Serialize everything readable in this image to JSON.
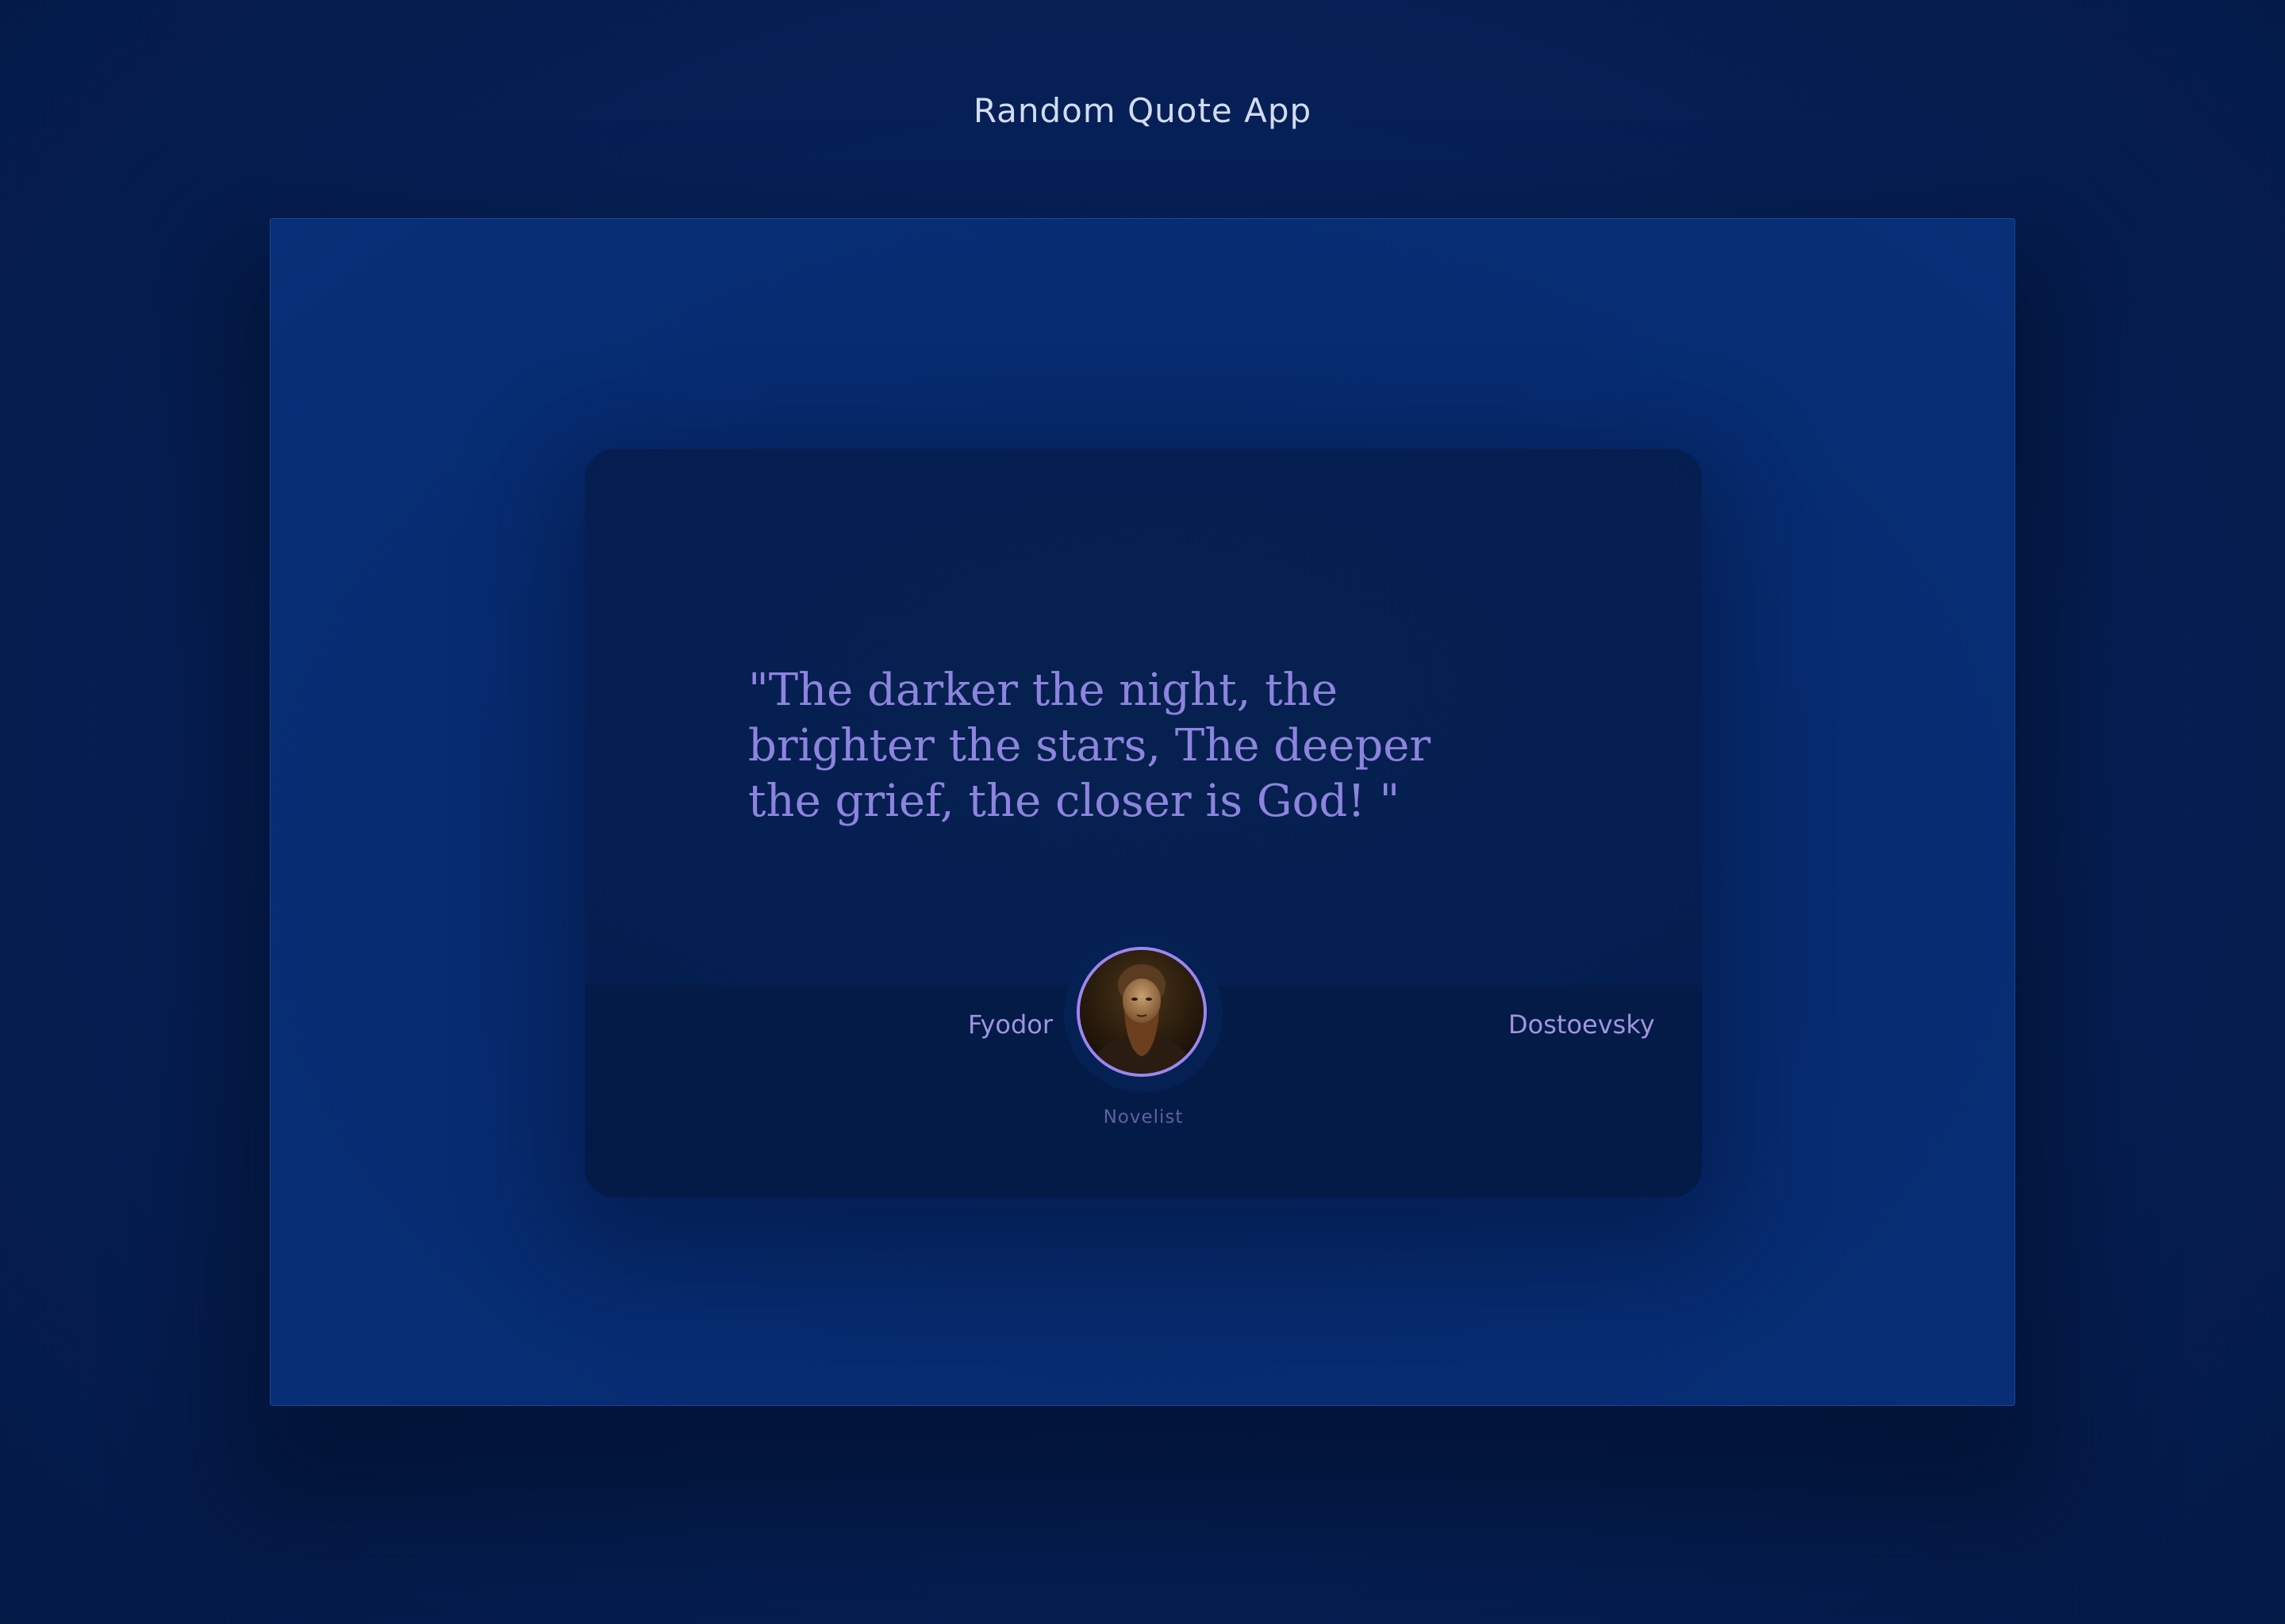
{
  "app": {
    "title": "Random Quote App"
  },
  "quote": {
    "text": "\"The darker the night, the brighter the stars, The deeper the grief, the closer is God! \""
  },
  "author": {
    "first_name": "Fyodor",
    "last_name": "Dostoevsky",
    "role": "Novelist"
  },
  "actions": {
    "share_icon": "twitter-icon",
    "bookmark_icon": "bookmark-icon"
  },
  "colors": {
    "background": "#062158",
    "card": "#051d52",
    "accent": "#8d84de",
    "avatar_ring": "#9c86ee",
    "title_text": "#d3dbef"
  }
}
